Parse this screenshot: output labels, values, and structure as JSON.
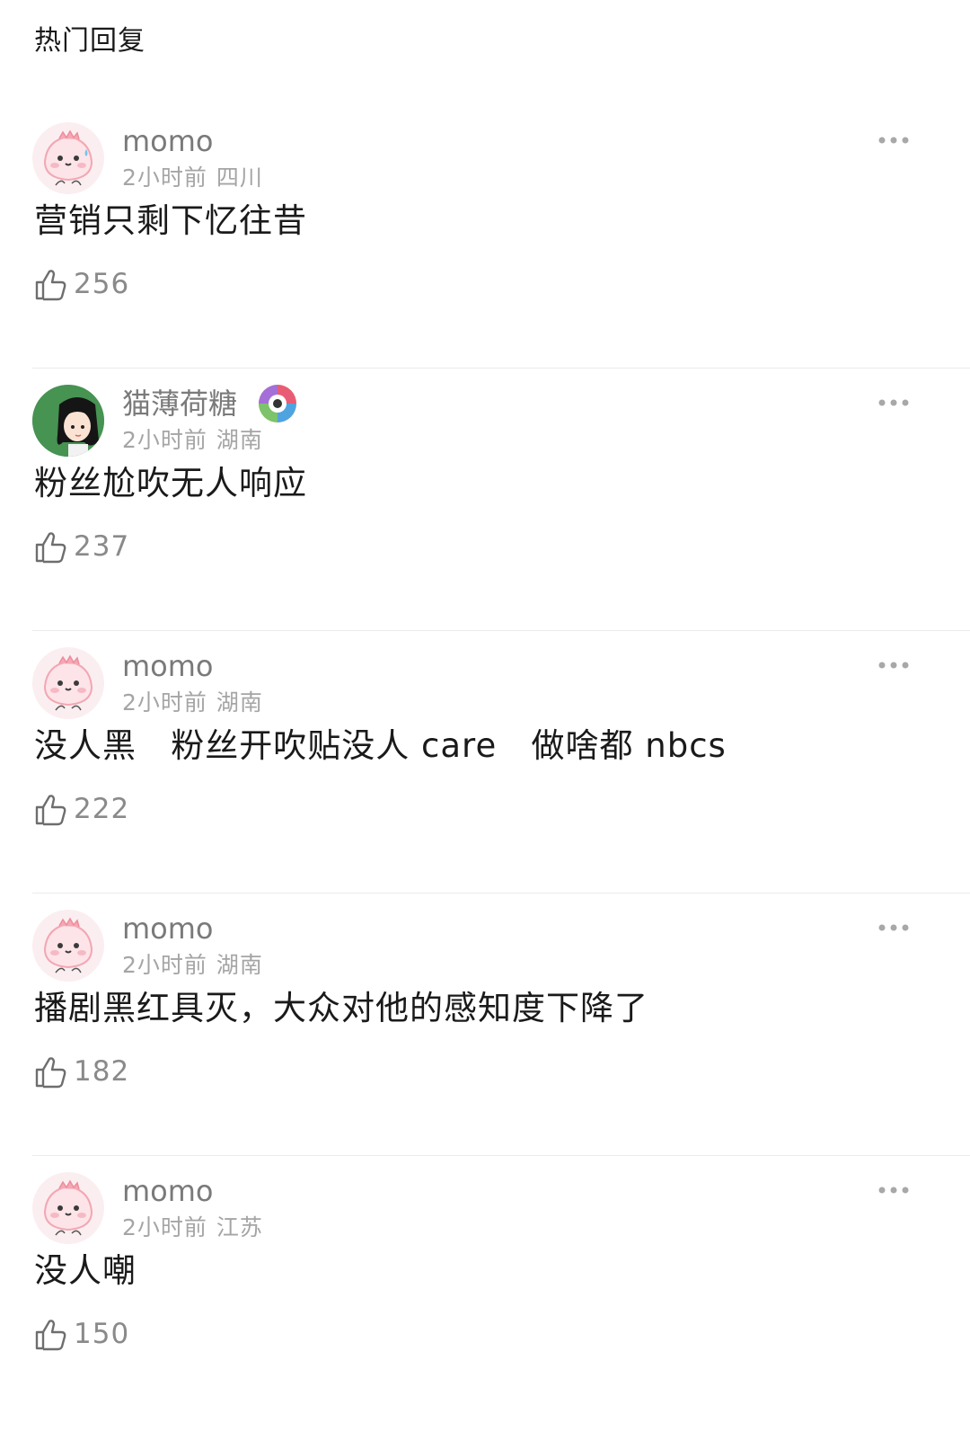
{
  "header": {
    "title": "热门回复"
  },
  "comments": [
    {
      "username": "momo",
      "time": "2小时前",
      "location": "四川",
      "text": "营销只剩下忆往昔",
      "likes": "256",
      "avatar": "pink-monster-avatar"
    },
    {
      "username": "猫薄荷糖",
      "time": "2小时前",
      "location": "湖南",
      "text": "粉丝尬吹无人响应",
      "likes": "237",
      "avatar": "girl-avatar",
      "badge": "colorful-badge-icon"
    },
    {
      "username": "momo",
      "time": "2小时前",
      "location": "湖南",
      "text": "没人黑   粉丝开吹贴没人 care   做啥都 nbcs",
      "likes": "222",
      "avatar": "pink-monster-avatar"
    },
    {
      "username": "momo",
      "time": "2小时前",
      "location": "湖南",
      "text": "播剧黑红具灭，大众对他的感知度下降了",
      "likes": "182",
      "avatar": "pink-monster-avatar"
    },
    {
      "username": "momo",
      "time": "2小时前",
      "location": "江苏",
      "text": "没人嘲",
      "likes": "150",
      "avatar": "pink-monster-avatar"
    }
  ],
  "colors": {
    "username": "#7a7a7a",
    "meta": "#a5a5a5",
    "body": "#1a1a1a",
    "divider": "#ebebeb"
  }
}
